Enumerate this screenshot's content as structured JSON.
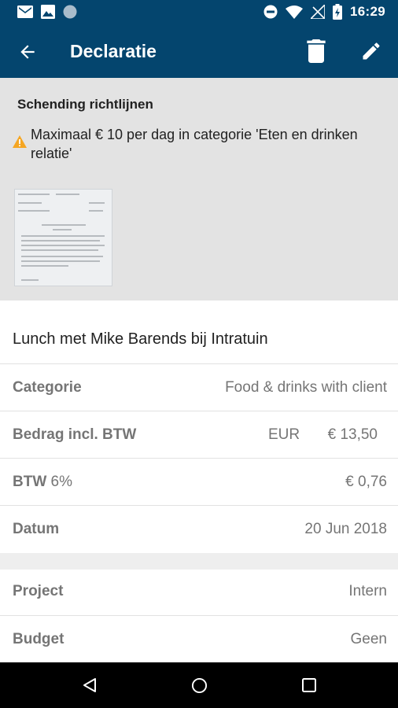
{
  "status_bar": {
    "time": "16:29",
    "left_icons": [
      "gmail-icon",
      "image-icon",
      "circle-icon"
    ],
    "right_icons": [
      "do-not-disturb-icon",
      "wifi-icon",
      "no-signal-icon",
      "battery-icon"
    ]
  },
  "app_bar": {
    "title": "Declaratie",
    "icons": [
      "arrow-back-icon",
      "trash-icon",
      "pencil-icon"
    ],
    "background": "#04456e"
  },
  "warning": {
    "title": "Schending richtlijnen",
    "message": "Maximaal € 10 per dag in categorie 'Eten en drinken relatie'",
    "icon": "warning-icon",
    "icon_color": "#f5a623"
  },
  "receipt": {
    "alt": "receipt-thumbnail"
  },
  "expense": {
    "description": "Lunch met Mike Barends bij Intratuin",
    "fields": [
      {
        "label": "Categorie",
        "value": "Food & drinks with client"
      },
      {
        "label": "Bedrag incl. BTW",
        "currency": "EUR",
        "value": "€ 13,50"
      },
      {
        "label": "BTW",
        "label_suffix": "6%",
        "value": "€ 0,76"
      },
      {
        "label": "Datum",
        "value": "20 Jun 2018"
      }
    ],
    "extra_fields": [
      {
        "label": "Project",
        "value": "Intern"
      },
      {
        "label": "Budget",
        "value": "Geen"
      }
    ]
  },
  "nav_bar": {
    "icons": [
      "nav-back-icon",
      "nav-home-icon",
      "nav-recents-icon"
    ]
  }
}
